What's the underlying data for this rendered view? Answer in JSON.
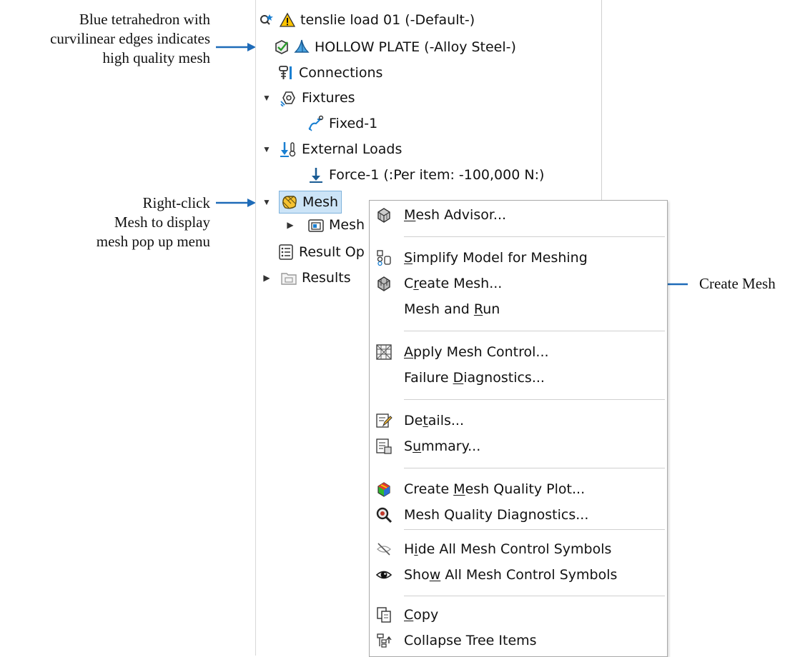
{
  "annotations": {
    "top": [
      "Blue tetrahedron with",
      "curvilinear edges indicates",
      "high quality mesh"
    ],
    "middle": [
      "Right-click",
      "Mesh to display",
      "mesh pop up menu"
    ],
    "right": "Create Mesh"
  },
  "arrow_color": "#1e6bb8",
  "tree": {
    "study": "tenslie load 01 (-Default-)",
    "part": "HOLLOW PLATE (-Alloy Steel-)",
    "connections": "Connections",
    "fixtures": "Fixtures",
    "fixed": "Fixed-1",
    "external_loads": "External Loads",
    "force": "Force-1 (:Per item: -100,000 N:)",
    "mesh": "Mesh",
    "mesh_child": "Mesh",
    "result_options": "Result Op",
    "results": "Results"
  },
  "menu": {
    "mesh_advisor": {
      "pre": "",
      "u": "M",
      "post": "esh Advisor..."
    },
    "simplify": {
      "pre": "",
      "u": "S",
      "post": "implify Model for Meshing"
    },
    "create_mesh": {
      "pre": "C",
      "u": "r",
      "post": "eate Mesh..."
    },
    "mesh_run": {
      "pre": "Mesh and ",
      "u": "R",
      "post": "un"
    },
    "apply_control": {
      "pre": "",
      "u": "A",
      "post": "pply Mesh Control..."
    },
    "failure": {
      "pre": "Failure ",
      "u": "D",
      "post": "iagnostics..."
    },
    "details": {
      "pre": "De",
      "u": "t",
      "post": "ails..."
    },
    "summary": {
      "pre": "S",
      "u": "u",
      "post": "mmary..."
    },
    "quality_plot": {
      "pre": "Create ",
      "u": "M",
      "post": "esh Quality Plot..."
    },
    "quality_diag": {
      "pre": "Mesh Quality Diagnostics...",
      "u": "",
      "post": ""
    },
    "hide_symbols": {
      "pre": "H",
      "u": "i",
      "post": "de All Mesh Control Symbols"
    },
    "show_symbols": {
      "pre": "Sho",
      "u": "w",
      "post": " All Mesh Control Symbols"
    },
    "copy": {
      "pre": "",
      "u": "C",
      "post": "opy"
    },
    "collapse": {
      "pre": "Collapse Tree Items",
      "u": "",
      "post": ""
    }
  }
}
